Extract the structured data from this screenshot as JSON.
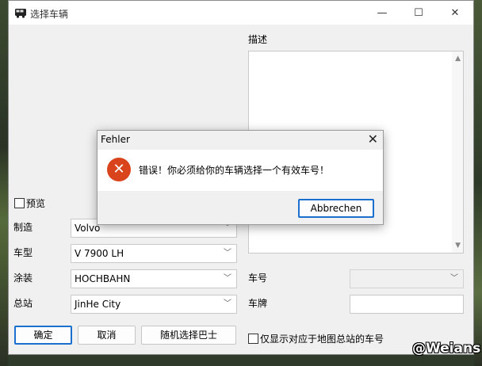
{
  "window": {
    "title": "选择车辆",
    "app_icon": "bus-icon",
    "controls": {
      "minimize": "—",
      "maximize": "☐",
      "close": "✕"
    }
  },
  "form": {
    "preview_label": "预览",
    "preview_checked": false,
    "manufacturer_label": "制造",
    "manufacturer_value": "Volvo",
    "model_label": "车型",
    "model_value": "V 7900 LH",
    "livery_label": "涂装",
    "livery_value": "HOCHBAHN",
    "depot_label": "总站",
    "depot_value": "JinHe City"
  },
  "buttons": {
    "ok": "确定",
    "cancel": "取消",
    "random": "随机选择巴士"
  },
  "right_panel": {
    "description_label": "描述",
    "description_text": "",
    "vehicle_number_label": "车号",
    "vehicle_number_value": "",
    "plate_label": "车牌",
    "plate_value": "",
    "only_depot_label": "仅显示对应于地图总站的车号",
    "only_depot_checked": false
  },
  "dialog": {
    "title": "Fehler",
    "message": "错误！你必须给你的车辆选择一个有效车号！",
    "icon": "error-icon",
    "button": "Abbrechen"
  },
  "watermark": "@Weians"
}
